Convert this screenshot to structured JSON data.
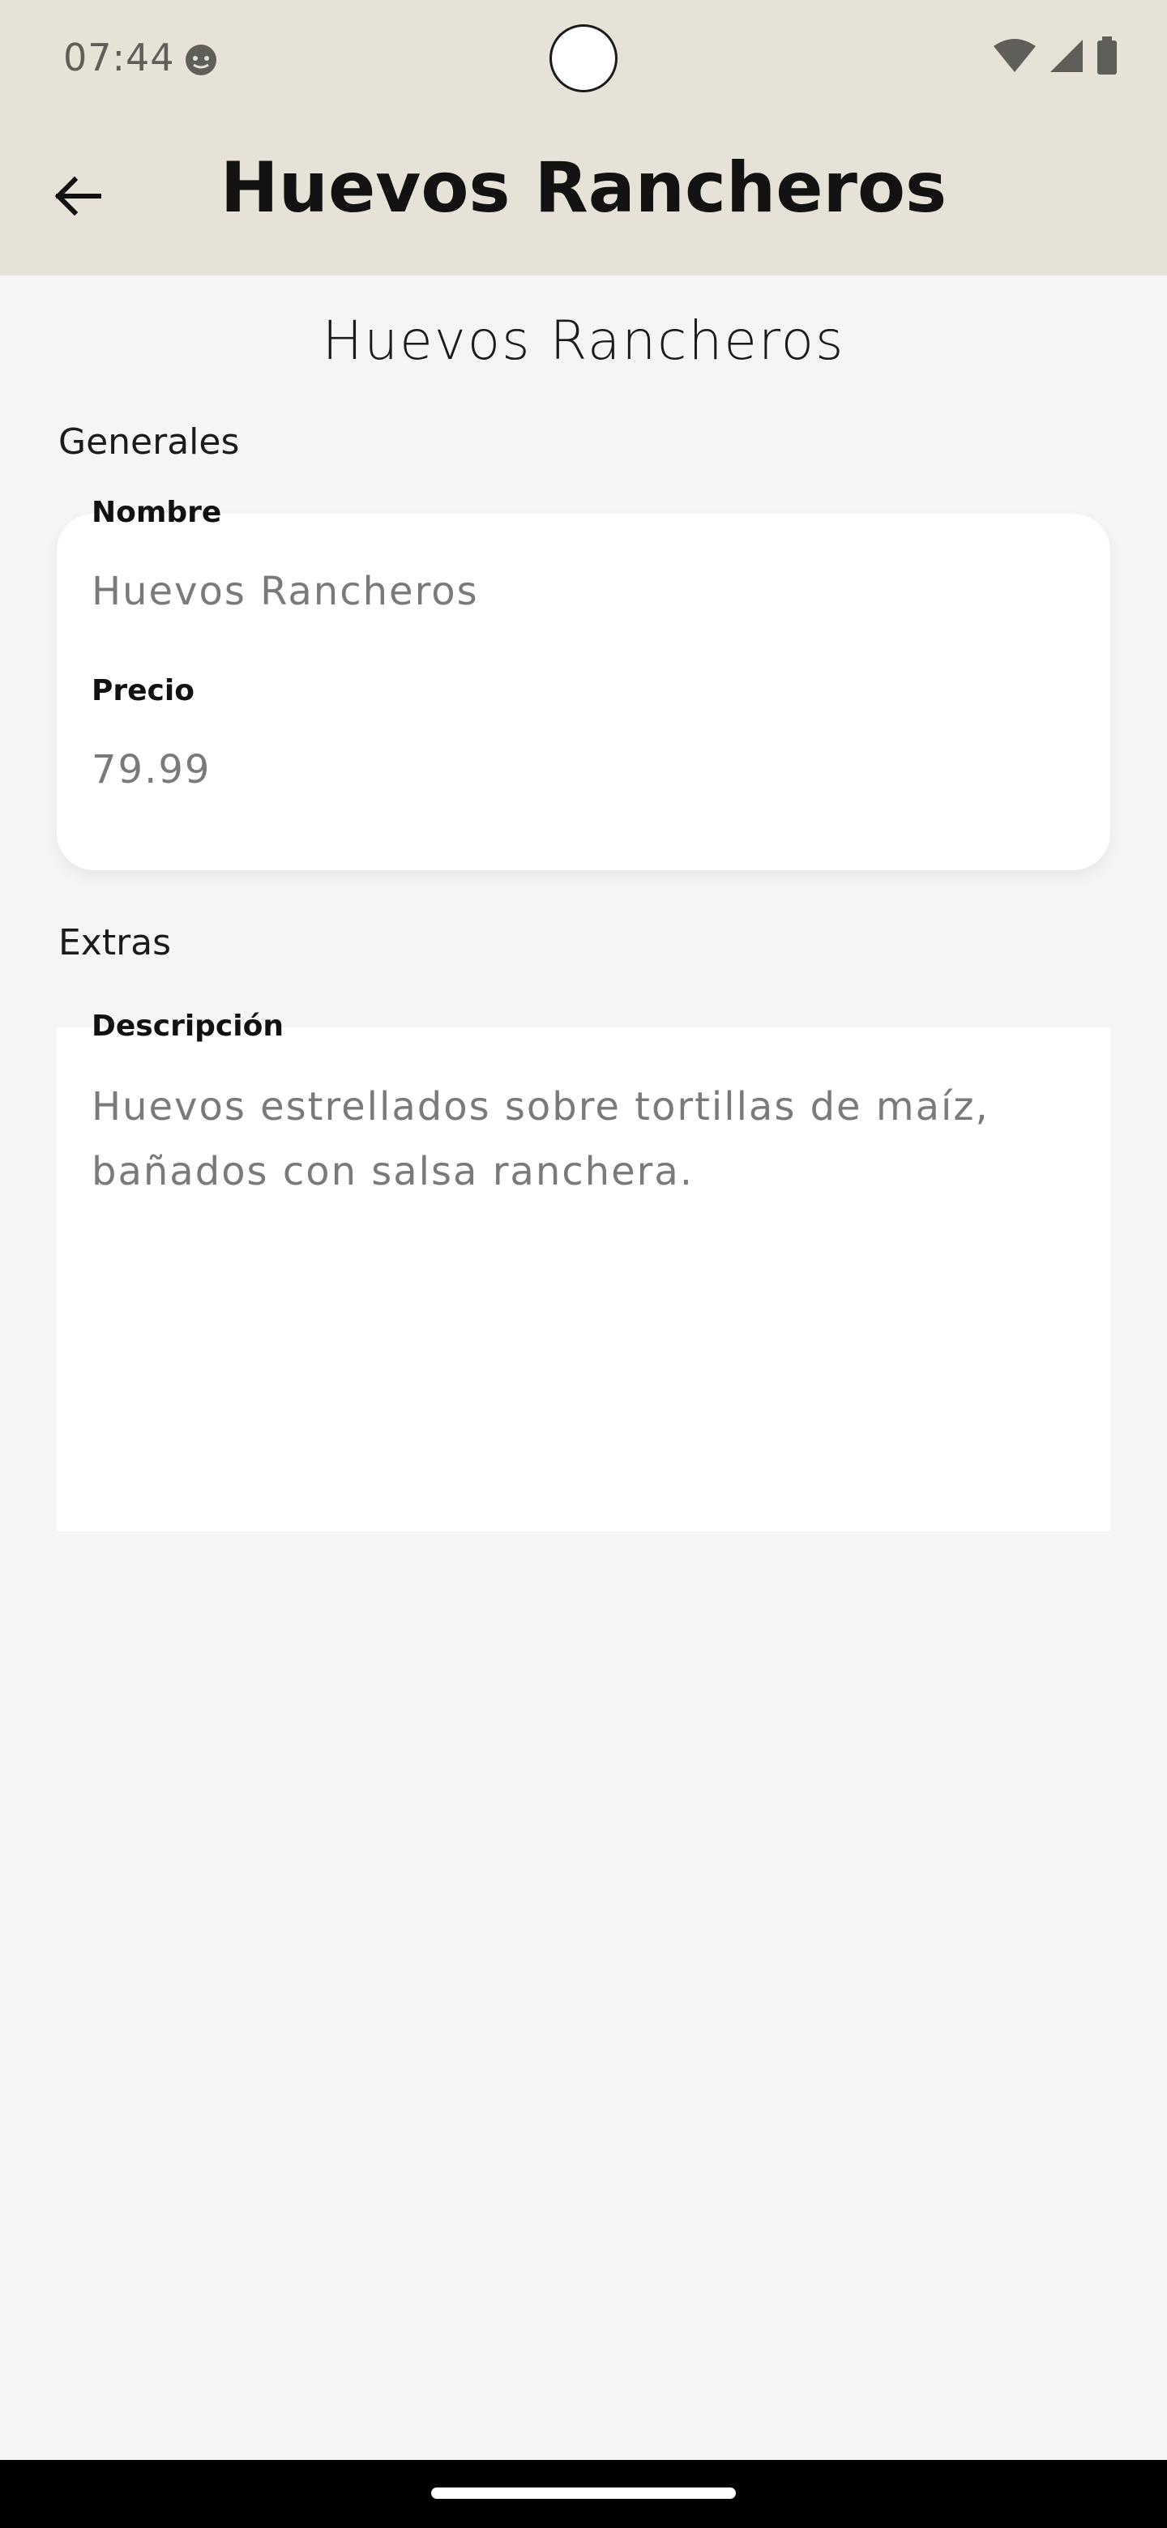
{
  "status_bar": {
    "time": "07:44",
    "notification_icon": "face-icon",
    "right_icons": [
      "wifi-icon",
      "signal-icon",
      "battery-icon"
    ]
  },
  "app_bar": {
    "back_icon": "arrow-back-icon",
    "title": "Huevos Rancheros",
    "background_color": "#e6e2d7"
  },
  "page": {
    "title": "Huevos Rancheros"
  },
  "sections": {
    "general": {
      "label": "Generales",
      "fields": {
        "name": {
          "label": "Nombre",
          "value": "Huevos Rancheros"
        },
        "price": {
          "label": "Precio",
          "value": "79.99"
        }
      }
    },
    "extras": {
      "label": "Extras",
      "fields": {
        "description": {
          "label": "Descripción",
          "value_line1": "Huevos estrellados sobre tortillas de maíz,",
          "value_line2": "bañados con salsa ranchera."
        }
      }
    }
  }
}
